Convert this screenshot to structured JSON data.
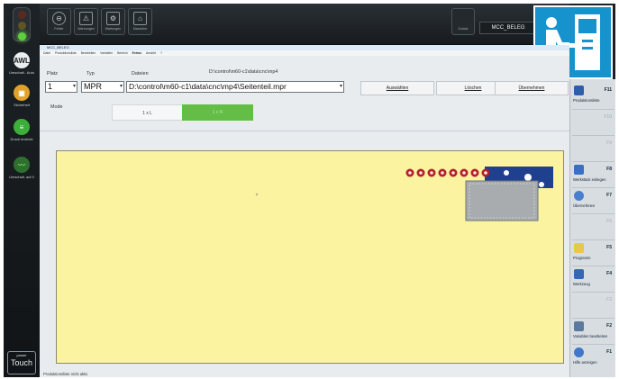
{
  "left_sidebar": {
    "buttons": [
      {
        "label": "AWL",
        "sub": "Umschalt.. Auto"
      },
      {
        "label": "",
        "sub": "Sicherheit"
      },
      {
        "label": "",
        "sub": "Druck erreicht"
      },
      {
        "label": "",
        "sub": "Umschalt. auf 0"
      }
    ],
    "power_touch": {
      "line1": "power",
      "line2": "Touch"
    }
  },
  "toolbar": {
    "buttons": [
      {
        "label": "Fehler",
        "icon": "stop-icon"
      },
      {
        "label": "Warnungen",
        "icon": "warning-icon"
      },
      {
        "label": "Wartungen",
        "icon": "maintenance-icon"
      },
      {
        "label": "Maschine",
        "icon": "machine-icon"
      }
    ],
    "back_label": "Zurück",
    "window_title": "MCC_BELEG"
  },
  "window": {
    "title": "MCC_BELEG",
    "menu": [
      "Datei",
      "Produktionsliste",
      "Bearbeiten",
      "Variablen",
      "Bereich",
      "Extras",
      "Ansicht",
      "?"
    ]
  },
  "form": {
    "platz_label": "Platz",
    "platz_value": "1",
    "typ_label": "Typ",
    "typ_value": "MPR",
    "dateien_label": "Dateien",
    "folder_hint": "D:\\control\\m60-c1\\data\\cnc\\mp4",
    "dateien_value": "D:\\control\\m60-c1\\data\\cnc\\mp4\\Seitenteil.mpr",
    "mode_label": "Mode",
    "mode_a": "1 x L",
    "mode_b": "1 x R"
  },
  "actions": {
    "auswaehlen": "Auswählen",
    "loeschen": "Löschen",
    "uebernehmen": "Übernehmen"
  },
  "function_keys": [
    {
      "key": "F11",
      "label": "Produktionsliste",
      "enabled": true
    },
    {
      "key": "F10",
      "label": "",
      "enabled": false
    },
    {
      "key": "F9",
      "label": "",
      "enabled": false
    },
    {
      "key": "F8",
      "label": "Werkstück einlegen",
      "enabled": true
    },
    {
      "key": "F7",
      "label": "Übernehmen",
      "enabled": true
    },
    {
      "key": "F6",
      "label": "",
      "enabled": false
    },
    {
      "key": "F5",
      "label": "Programm",
      "enabled": true
    },
    {
      "key": "F4",
      "label": "Werkzeug",
      "enabled": true
    },
    {
      "key": "F3",
      "label": "",
      "enabled": false
    },
    {
      "key": "F2",
      "label": "Variablen bearbeiten",
      "enabled": true
    },
    {
      "key": "F1",
      "label": "Hilfe anzeigen",
      "enabled": true
    }
  ],
  "status_text": "Produktionsliste nicht aktiv",
  "colors": {
    "panel": "#fbf3a0",
    "mode_active": "#63bd47",
    "logo": "#1692cd",
    "clamp": "#b3202a",
    "beam": "#1f3f8f"
  }
}
